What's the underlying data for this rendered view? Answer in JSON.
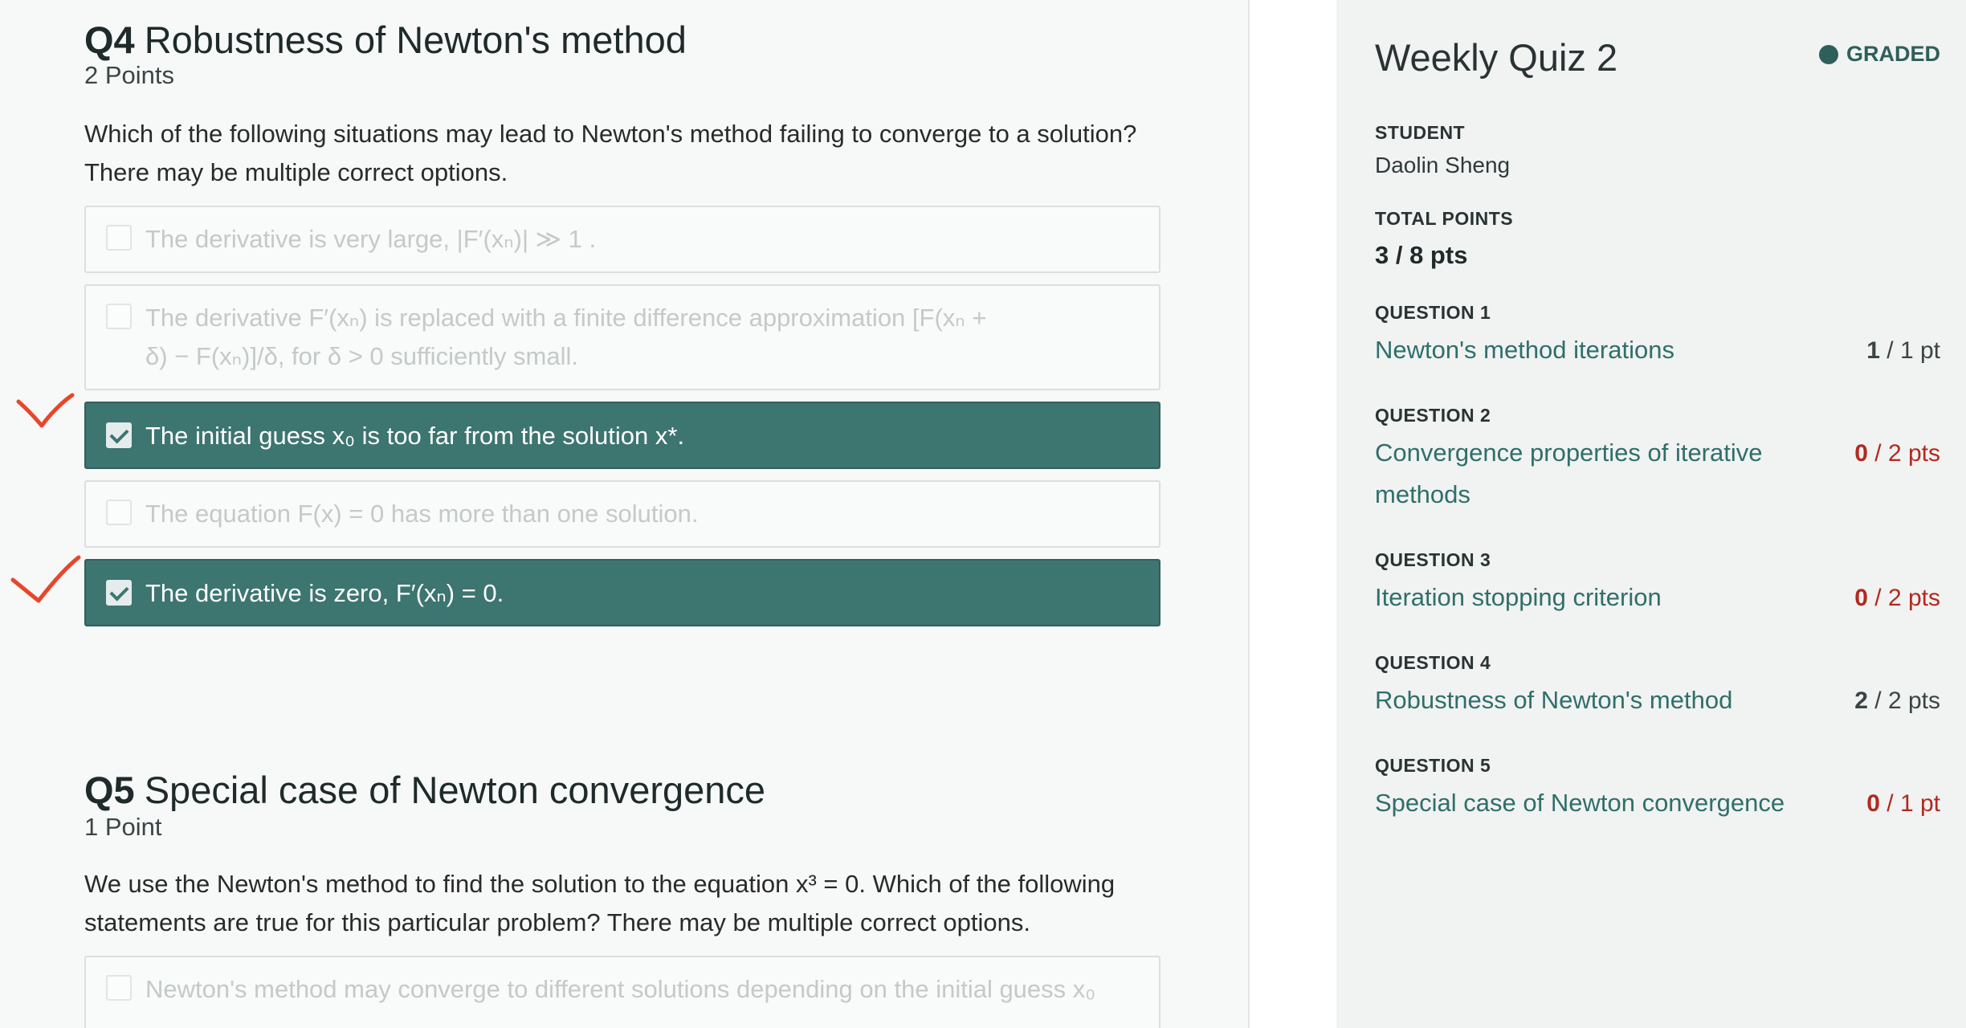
{
  "questions": [
    {
      "number": "Q4",
      "title": "Robustness of Newton's method",
      "points": "2 Points",
      "prompt": "Which of the following situations may lead to Newton's method failing to converge to a solution? There may be multiple correct options.",
      "options": [
        {
          "text": "The derivative is very large, |F′(xₙ)| ≫ 1 .",
          "selected": false
        },
        {
          "text_line1": "The derivative F′(xₙ) is replaced with a finite difference approximation [F(xₙ +",
          "text_line2": "δ) − F(xₙ)]/δ, for δ > 0 sufficiently small.",
          "selected": false
        },
        {
          "text": "The initial guess x₀ is too far from the solution x*.",
          "selected": true
        },
        {
          "text": "The equation F(x) = 0 has more than one solution.",
          "selected": false
        },
        {
          "text": "The derivative is zero, F′(xₙ) = 0.",
          "selected": true
        }
      ]
    },
    {
      "number": "Q5",
      "title": "Special case of Newton convergence",
      "points": "1 Point",
      "prompt": "We use the Newton's method to find the solution to the equation x³ = 0. Which of the following statements are true for this particular problem? There may be multiple correct options.",
      "options": [
        {
          "text": "Newton's method may converge to different solutions depending on the initial guess x₀",
          "selected": false
        }
      ]
    }
  ],
  "summary": {
    "quiz_title": "Weekly Quiz 2",
    "status": "GRADED",
    "student_label": "STUDENT",
    "student_name": "Daolin Sheng",
    "total_label": "TOTAL POINTS",
    "total_value": "3 / 8 pts",
    "items": [
      {
        "label": "QUESTION 1",
        "title": "Newton's method iterations",
        "earned": "1",
        "possible": " / 1 pt",
        "color": "#3a4444"
      },
      {
        "label": "QUESTION 2",
        "title": "Convergence properties of iterative methods",
        "earned": "0",
        "possible": " / 2 pts",
        "color": "#b2291e"
      },
      {
        "label": "QUESTION 3",
        "title": "Iteration stopping criterion",
        "earned": "0",
        "possible": " / 2 pts",
        "color": "#b2291e"
      },
      {
        "label": "QUESTION 4",
        "title": "Robustness of Newton's method",
        "earned": "2",
        "possible": " / 2 pts",
        "color": "#3a4444"
      },
      {
        "label": "QUESTION 5",
        "title": "Special case of Newton convergence",
        "earned": "0",
        "possible": " / 1 pt",
        "color": "#b2291e"
      }
    ]
  },
  "colors": {
    "selected_option": "#3d7570",
    "link": "#2f6f6a",
    "score_zero": "#b2291e",
    "annotation": "#e8462a"
  }
}
